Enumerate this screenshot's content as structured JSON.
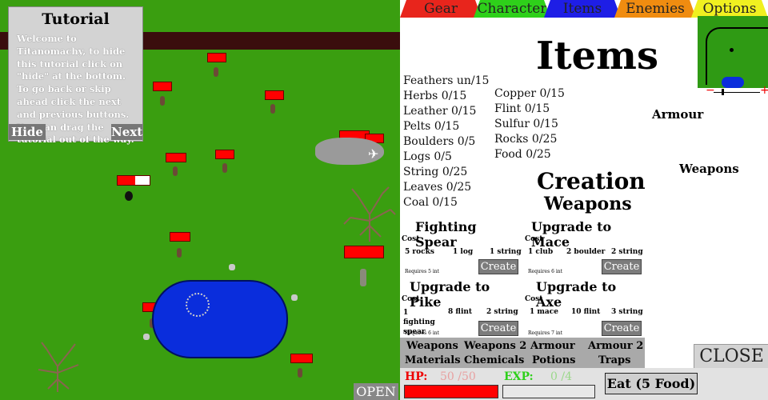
{
  "tutorial": {
    "title": "Tutorial",
    "body": "Welcome to Titanomachy, to hide this tutorial click on \"hide\" at the bottom. To go back or skip ahead click the next and previous buttons. You can drag the tutorial out of the way.",
    "hide_label": "Hide",
    "next_label": "Next"
  },
  "world": {
    "open_label": "OPEN",
    "colors": {
      "grass": "#3a9e10",
      "road": "#3a0d0d",
      "water": "#0a2ddc",
      "health": "#ff0000"
    }
  },
  "tabs": [
    {
      "label": "Gear",
      "color": "#e8251c"
    },
    {
      "label": "Character",
      "color": "#2ed01a"
    },
    {
      "label": "Items",
      "color": "#1e1ee6"
    },
    {
      "label": "Enemies",
      "color": "#f08c10"
    },
    {
      "label": "Options",
      "color": "#f0f020"
    }
  ],
  "items": {
    "title": "Items",
    "resources_left": [
      "Feathers  un/15",
      "Herbs   0/15",
      "Leather   0/15",
      "Pelts   0/15",
      "Boulders   0/5",
      "Logs   0/5",
      "String   0/25",
      "Leaves   0/25",
      "Coal   0/15"
    ],
    "resources_right": [
      "Copper   0/15",
      "Flint   0/15",
      "Sulfur   0/15",
      "Rocks   0/25",
      "Food   0/25"
    ],
    "armour_label": "Armour",
    "weapons_label": "Weapons"
  },
  "creation": {
    "title": "Creation",
    "subtitle": "Weapons",
    "cost_label": "Cost",
    "create_label": "Create",
    "recipes": [
      {
        "name": "Fighting Spear",
        "costs": [
          "5 rocks",
          "1 log",
          "1 string"
        ],
        "requires": "Requires 5 int"
      },
      {
        "name": "Upgrade to Mace",
        "costs": [
          "1 club",
          "2 boulder",
          "2 string"
        ],
        "requires": "Requires 6 int"
      },
      {
        "name": "Upgrade to Pike",
        "costs": [
          "1 fighting spear",
          "8 flint",
          "2 string"
        ],
        "requires": "Requires 6 int"
      },
      {
        "name": "Upgrade to Axe",
        "costs": [
          "1 mace",
          "10 flint",
          "3 string"
        ],
        "requires": "Requires 7 int"
      }
    ]
  },
  "categories": [
    "Weapons",
    "Weapons 2",
    "Armour",
    "Armour 2",
    "Materials",
    "Chemicals",
    "Potions",
    "Traps"
  ],
  "close_label": "CLOSE",
  "status": {
    "hp_label": "HP:",
    "hp_current": "50",
    "hp_max": "50",
    "hp_fraction": 1.0,
    "exp_label": "EXP:",
    "exp_current": "0",
    "exp_max": "4",
    "exp_fraction": 0.0,
    "eat_label": "Eat (5 Food)"
  }
}
